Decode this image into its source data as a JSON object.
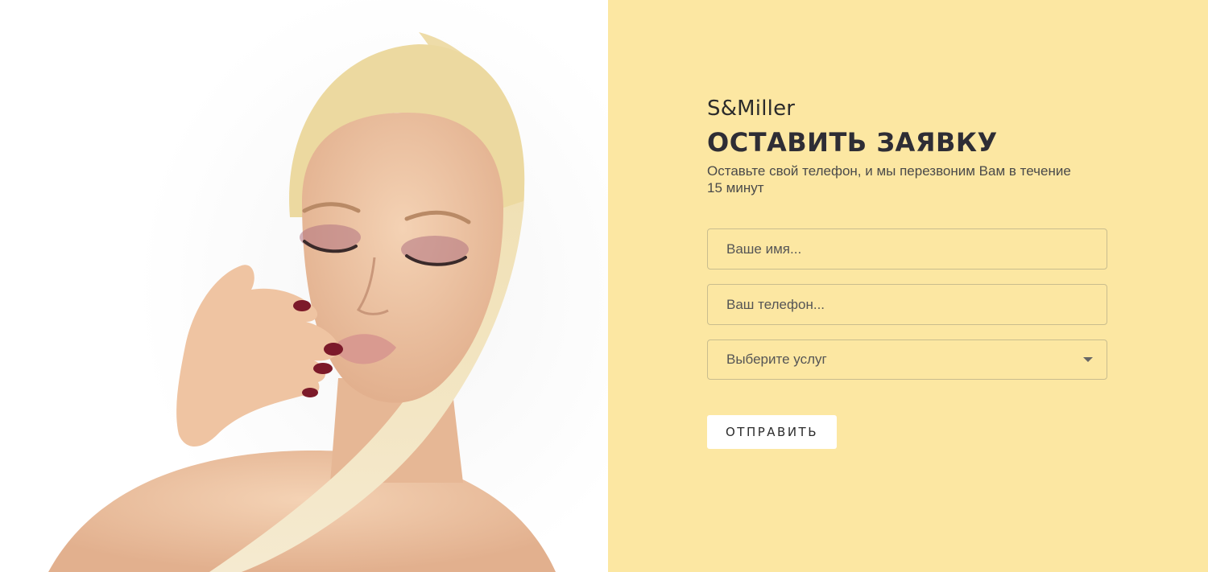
{
  "brand": {
    "name": "S&Miller"
  },
  "form": {
    "title": "ОСТАВИТЬ ЗАЯВКУ",
    "subtitle": "Оставьте свой телефон, и мы перезвоним Вам в течение 15 минут",
    "name_placeholder": "Ваше имя...",
    "phone_placeholder": "Ваш телефон...",
    "service_select": {
      "selected": "Выберите услуг"
    },
    "submit_label": "ОТПРАВИТЬ"
  },
  "hero_image": {
    "icon": "model-portrait-photo"
  },
  "colors": {
    "panel_background": "#fce7a2",
    "title_text": "#2e2d35",
    "button_background": "#ffffff"
  }
}
